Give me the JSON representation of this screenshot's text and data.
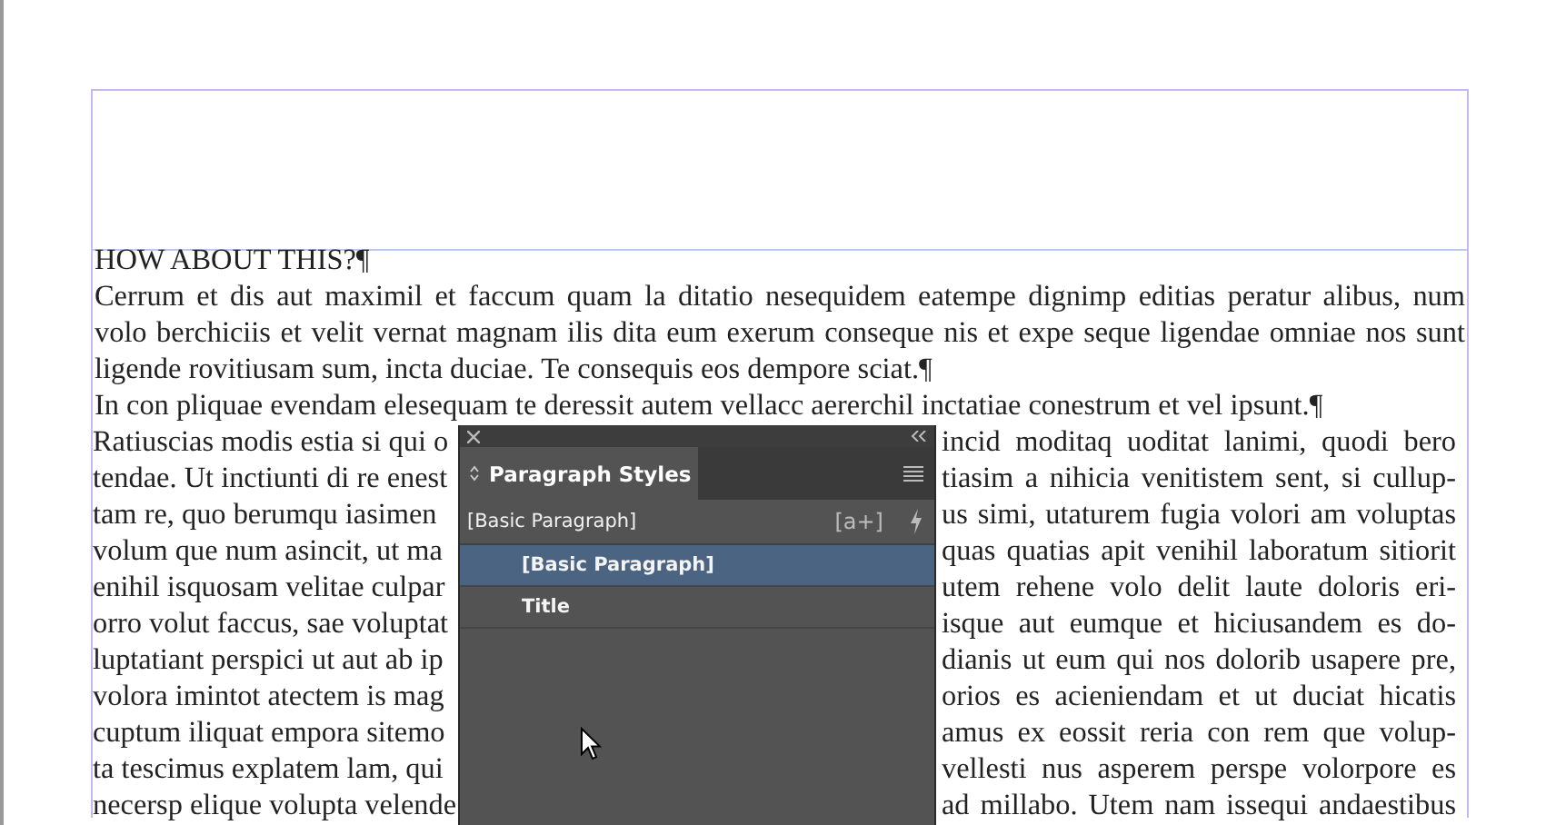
{
  "document": {
    "lines": [
      {
        "text": "HOW ABOUT THIS?¶",
        "paragraph_end": true
      },
      {
        "text": "Cerrum et dis aut maximil et faccum quam la ditatio nesequidem eatempe dignimp editias peratur alibus, num",
        "paragraph_end": false
      },
      {
        "text": "volo berchiciis et velit vernat magnam ilis dita eum exerum conseque nis et expe seque ligendae omniae nos sunt",
        "paragraph_end": false
      },
      {
        "text": "ligende rovitiusam sum, incta duciae. Te consequis eos dempore sciat.¶",
        "paragraph_end": true
      },
      {
        "text": "In con pliquae evendam elesequam te deressit autem vellacc aererchil inctatiae conestrum et vel ipsunt.¶",
        "paragraph_end": true
      }
    ],
    "split_lines": [
      {
        "left": "Ratiuscias modis estia si qui o",
        "right": "incid moditaq uoditat lanimi, quodi bero"
      },
      {
        "left": "tendae. Ut inctiunti di re enest",
        "right": "tiasim a nihicia venitistem sent, si cullup-"
      },
      {
        "left": "tam re, quo berumqu iasimen",
        "right": "us simi, utaturem fugia volori am voluptas"
      },
      {
        "left": "volum que num asincit, ut ma",
        "right": "quas quatias apit venihil laboratum sitiorit"
      },
      {
        "left": "enihil isquosam velitae culpar",
        "right": "utem rehene volo delit laute doloris eri-"
      },
      {
        "left": "orro volut faccus, sae voluptat",
        "right": "isque aut eumque et hiciusandem es do-"
      },
      {
        "left": "luptatiant perspici ut aut ab ip",
        "right": "dianis ut eum qui nos dolorib usapere pre,"
      },
      {
        "left": "volora imintot atectem is mag",
        "right": "orios es acieniendam et ut duciat hicatis"
      },
      {
        "left": "cuptum iliquat empora sitemo",
        "right": "amus ex eossit reria con rem que volup-"
      },
      {
        "left": "ta tescimus explatem lam, qui",
        "right": "vellesti nus asperem perspe volorpore es"
      },
      {
        "left": "necersp elique volupta velende",
        "right": "ad millabo. Utem nam issequi andaestibus"
      }
    ]
  },
  "panel": {
    "tab": "Paragraph Styles",
    "current_style": "[Basic Paragraph]",
    "new_style_button": "[a+]",
    "styles": [
      {
        "name": "[Basic Paragraph]",
        "selected": true
      },
      {
        "name": "Title",
        "selected": false
      }
    ]
  }
}
